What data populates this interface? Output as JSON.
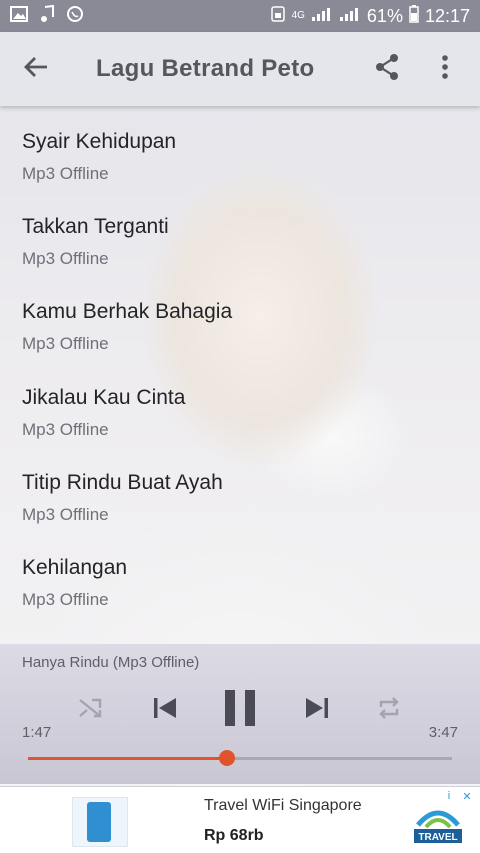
{
  "status_bar": {
    "network": "4G",
    "battery": "61%",
    "time": "12:17"
  },
  "app_bar": {
    "title": "Lagu Betrand Peto",
    "icons": [
      "back-arrow-icon",
      "share-icon",
      "more-vert-icon"
    ]
  },
  "songs": [
    {
      "title": "Syair Kehidupan",
      "subtitle": "Mp3 Offline"
    },
    {
      "title": "Takkan Terganti",
      "subtitle": "Mp3 Offline"
    },
    {
      "title": "Kamu Berhak Bahagia",
      "subtitle": "Mp3 Offline"
    },
    {
      "title": "Jikalau Kau Cinta",
      "subtitle": "Mp3 Offline"
    },
    {
      "title": "Titip Rindu Buat Ayah",
      "subtitle": "Mp3 Offline"
    },
    {
      "title": "Kehilangan",
      "subtitle": "Mp3 Offline"
    }
  ],
  "player": {
    "now_playing": "Hanya Rindu (Mp3 Offline)",
    "current_time": "1:47",
    "total_time": "3:47",
    "progress": 0.47,
    "accent_color": "#e0532c",
    "icons": [
      "shuffle-icon",
      "previous-icon",
      "pause-icon",
      "next-icon",
      "repeat-icon"
    ]
  },
  "ad": {
    "title": "Travel WiFi Singapore",
    "price": "Rp 68rb",
    "logo_text": "TRAVEL"
  }
}
